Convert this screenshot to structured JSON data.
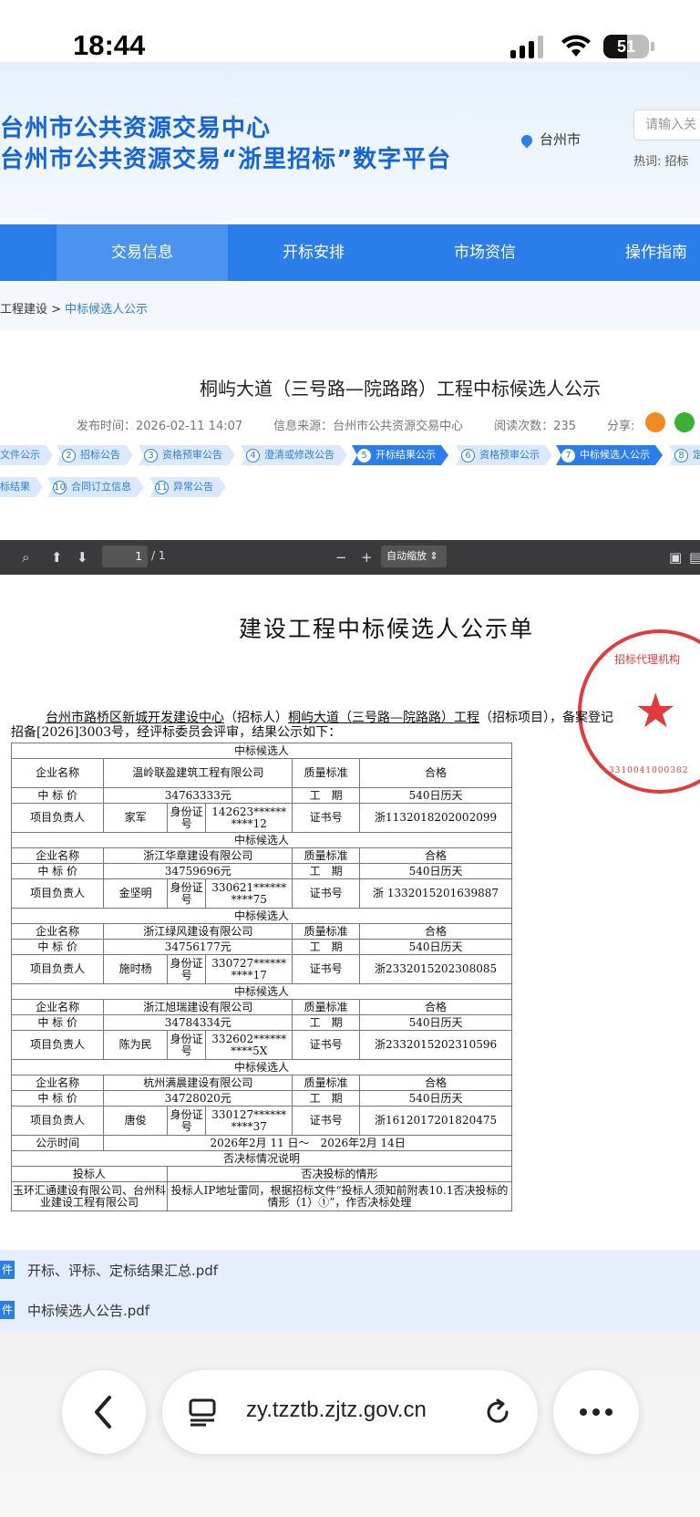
{
  "status_bar": {
    "time": "18:44",
    "battery": "51",
    "battery_level": 0.51
  },
  "header": {
    "title_line1": "台州市公共资源交易中心",
    "title_line2": "台州市公共资源交易“浙里招标”数字平台",
    "location": "台州市",
    "search_placeholder": "请输入关",
    "hot_words": "热词:  招标"
  },
  "nav": [
    "交易信息",
    "开标安排",
    "市场资信",
    "操作指南"
  ],
  "breadcrumb": {
    "parent": "工程建设 > ",
    "current": "中标候选人公示"
  },
  "article": {
    "title": "桐屿大道（三号路—院路路）工程中标候选人公示",
    "publish": "发布时间：2026-02-11 14:07",
    "source": "信息来源：台州市公共资源交易中心",
    "reads": "阅读次数：235",
    "share": "分享:"
  },
  "steps_row1": [
    {
      "n": "",
      "label": "文件公示"
    },
    {
      "n": "2",
      "label": "招标公告"
    },
    {
      "n": "3",
      "label": "资格预审公告"
    },
    {
      "n": "4",
      "label": "澄清或修改公告"
    },
    {
      "n": "5",
      "label": "开标结果公示"
    },
    {
      "n": "6",
      "label": "资格预审公示"
    },
    {
      "n": "7",
      "label": "中标候选人公示"
    },
    {
      "n": "8",
      "label": "定"
    }
  ],
  "steps_row2": [
    {
      "n": "",
      "label": "标结果"
    },
    {
      "n": "10",
      "label": "合同订立信息"
    },
    {
      "n": "11",
      "label": "异常公告"
    }
  ],
  "pdf_toolbar": {
    "page": "1",
    "total": "/ 1",
    "zoom": "自动缩放"
  },
  "pdf": {
    "doc_title": "建设工程中标候选人公示单",
    "seal_top": "招标代理机构",
    "seal_bottom": "3310041000382",
    "intro_a": "台州市路桥区新城开发建设中心",
    "intro_b": "（招标人）",
    "intro_c": "桐屿大道（三号路—院路路）工程",
    "intro_d": "（招标项目），备案登记",
    "intro2": "招备[2026]3003号，经评标委员会评审，结果公示如下：",
    "labels": {
      "candidate": "中标候选人",
      "company": "企业名称",
      "price": "中 标 价",
      "manager": "项目负责人",
      "quality": "质量标准",
      "period": "工　期",
      "idno": "身份证号",
      "cert": "证书号",
      "notice_time": "公示时间",
      "reject_header": "否决标情况说明",
      "bidder": "投标人",
      "reject_case": "否决投标的情形"
    },
    "candidates": [
      {
        "company": "温岭联盈建筑工程有限公司",
        "price": "34763333元",
        "quality": "合格",
        "period": "540日历天",
        "manager": "家军",
        "id": "142623****** ****12",
        "cert": "浙1132018202002099"
      },
      {
        "company": "浙江华章建设有限公司",
        "price": "34759696元",
        "quality": "合格",
        "period": "540日历天",
        "manager": "金坚明",
        "id": "330621****** ****75",
        "cert": "浙 1332015201639887"
      },
      {
        "company": "浙江绿风建设有限公司",
        "price": "34756177元",
        "quality": "合格",
        "period": "540日历天",
        "manager": "施时杨",
        "id": "330727****** ****17",
        "cert": "浙2332015202308085"
      },
      {
        "company": "浙江旭瑞建设有限公司",
        "price": "34784334元",
        "quality": "合格",
        "period": "540日历天",
        "manager": "陈为民",
        "id": "332602****** ****5X",
        "cert": "浙2332015202310596"
      },
      {
        "company": "杭州满晨建设有限公司",
        "price": "34728020元",
        "quality": "合格",
        "period": "540日历天",
        "manager": "唐俊",
        "id": "330127****** ****37",
        "cert": "浙1612017201820475"
      }
    ],
    "notice_period": "2026年2月 11 日～　2026年2月 14日",
    "reject_bidders": "玉环汇通建设有限公司、台州科业建设工程有限公司",
    "reject_reason": "投标人IP地址雷同，根据招标文件“投标人须知前附表10.1否决投标的情形（1）①”，作否决标处理"
  },
  "attachments": [
    {
      "tag": "件",
      "name": "开标、评标、定标结果汇总.pdf"
    },
    {
      "tag": "件",
      "name": "中标候选人公告.pdf"
    }
  ],
  "browser": {
    "url": "zy.tzztb.zjtz.gov.cn"
  },
  "colors": {
    "brand": "#2b7de9",
    "seal": "#e23b3b"
  }
}
